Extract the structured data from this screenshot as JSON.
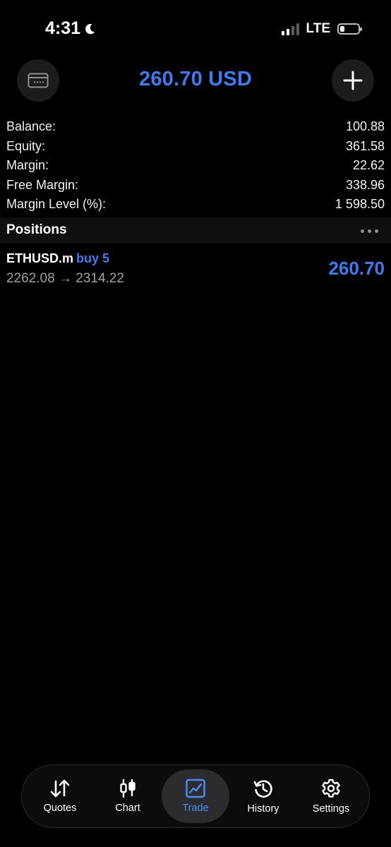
{
  "status_bar": {
    "time": "4:31",
    "network": "LTE"
  },
  "header": {
    "title": "260.70 USD"
  },
  "account": {
    "rows": [
      {
        "label": "Balance:",
        "value": "100.88"
      },
      {
        "label": "Equity:",
        "value": "361.58"
      },
      {
        "label": "Margin:",
        "value": "22.62"
      },
      {
        "label": "Free Margin:",
        "value": "338.96"
      },
      {
        "label": "Margin Level (%):",
        "value": "1 598.50"
      }
    ]
  },
  "positions": {
    "title": "Positions",
    "items": [
      {
        "symbol": "ETHUSD.m",
        "side": "buy 5",
        "prices": "2262.08 → 2314.22",
        "profit": "260.70"
      }
    ]
  },
  "tabs": [
    {
      "label": "Quotes",
      "icon": "arrows-up-down-icon"
    },
    {
      "label": "Chart",
      "icon": "candlestick-icon"
    },
    {
      "label": "Trade",
      "icon": "trend-chart-icon",
      "active": true
    },
    {
      "label": "History",
      "icon": "history-clock-icon"
    },
    {
      "label": "Settings",
      "icon": "gear-icon"
    }
  ],
  "colors": {
    "accent": "#3b7cf0",
    "background": "#000000",
    "secondary_text": "#a0a0a0"
  }
}
